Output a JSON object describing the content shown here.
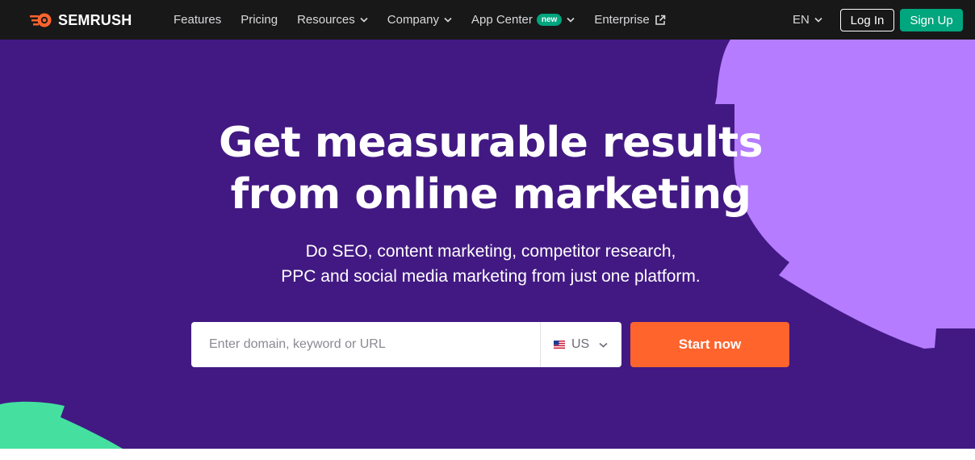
{
  "brand": {
    "name": "SEMRUSH",
    "accent": "#ff642d",
    "green": "#00a67e",
    "purple": "#421983",
    "lilac": "#b57cff",
    "mint": "#45e0a0"
  },
  "nav": {
    "items": [
      {
        "label": "Features",
        "has_dropdown": false
      },
      {
        "label": "Pricing",
        "has_dropdown": false
      },
      {
        "label": "Resources",
        "has_dropdown": true
      },
      {
        "label": "Company",
        "has_dropdown": true
      },
      {
        "label": "App Center",
        "badge": "new",
        "has_dropdown": true
      },
      {
        "label": "Enterprise",
        "external": true
      }
    ],
    "language": "EN",
    "login": "Log In",
    "signup": "Sign Up"
  },
  "hero": {
    "headline_line1": "Get measurable results",
    "headline_line2": "from online marketing",
    "sub_line1": "Do SEO, content marketing, competitor research,",
    "sub_line2": "PPC and social media marketing from just one platform.",
    "search": {
      "placeholder": "Enter domain, keyword or URL",
      "value": ""
    },
    "country": {
      "code": "US",
      "icon": "us-flag-icon"
    },
    "cta": "Start now"
  }
}
